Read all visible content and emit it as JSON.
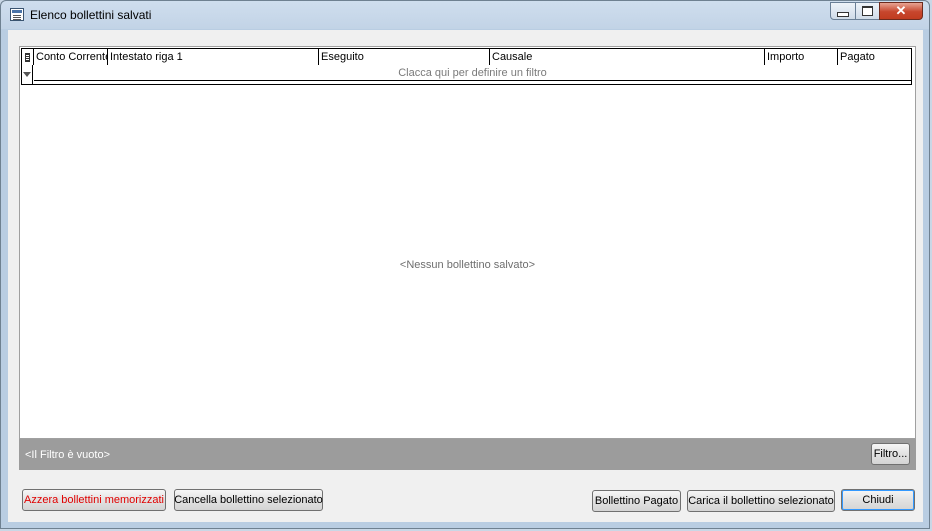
{
  "window": {
    "title": "Elenco bollettini salvati",
    "controls": {
      "minimize": "–",
      "maximize": "□",
      "close": "✕"
    }
  },
  "grid": {
    "columns": [
      "Conto Corrente",
      "Intestato riga 1",
      "Eseguito",
      "Causale",
      "Importo",
      "Pagato"
    ],
    "filter_hint": "Clacca qui per definire un filtro",
    "empty_message": "<Nessun bollettino salvato>"
  },
  "filter_bar": {
    "status": "<Il Filtro è vuoto>",
    "button": "Filtro..."
  },
  "buttons": {
    "reset": "Azzera bollettini memorizzati",
    "delete": "Cancella bollettino selezionato",
    "paid": "Bollettino Pagato",
    "load": "Carica il bollettino selezionato",
    "close": "Chiudi"
  },
  "colors": {
    "reset_text": "#e00000",
    "filter_bar": "#9c9c9c",
    "close_button": "#c7462d"
  }
}
